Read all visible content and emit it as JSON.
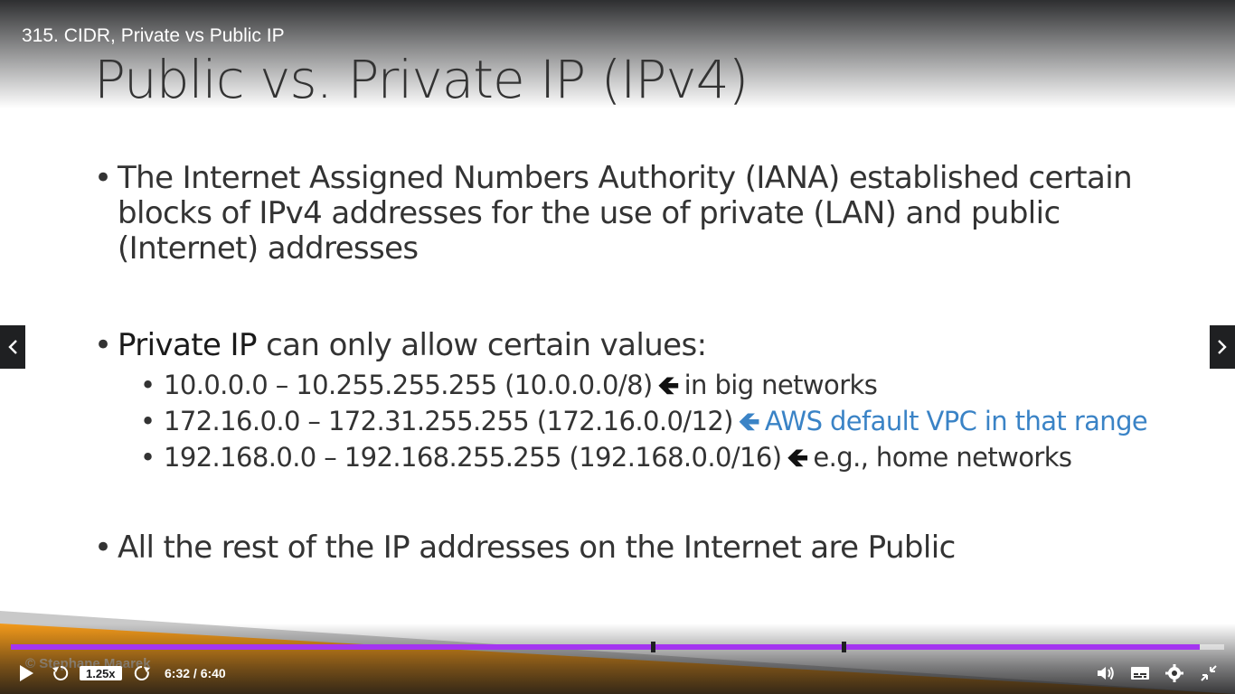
{
  "player": {
    "video_title": "315. CIDR, Private vs Public IP",
    "speed_label": "1.25x",
    "time_display": "6:32 / 6:40",
    "progress_fraction": 0.98,
    "marker_fractions": [
      0.529,
      0.686
    ],
    "colors": {
      "progress": "#a435f0",
      "accent_orange": "#f39a1a"
    },
    "icons": {
      "play": "play-icon",
      "rewind": "rewind-5-icon",
      "forward": "forward-5-icon",
      "volume": "volume-icon",
      "captions": "captions-icon",
      "settings": "gear-icon",
      "fullscreen": "exit-fullscreen-icon",
      "prev": "chevron-left-icon",
      "next": "chevron-right-icon"
    }
  },
  "slide": {
    "title": "Public vs. Private IP (IPv4)",
    "bullet1": "The Internet Assigned Numbers Authority (IANA) established certain blocks of IPv4 addresses for the use of private (LAN) and public (Internet) addresses",
    "bullet2_bold": "Private IP",
    "bullet2_rest": " can only allow certain values:",
    "sub_items": [
      {
        "range": "10.0.0.0 – 10.255.255.255  (10.0.0.0/8)",
        "note": "in big networks"
      },
      {
        "range": "172.16.0.0 – 172.31.255.255 (172.16.0.0/12)",
        "note": "AWS default VPC in that range"
      },
      {
        "range": "192.168.0.0 – 192.168.255.255 (192.168.0.0/16)",
        "note": "e.g., home networks"
      }
    ],
    "bullet3": "All the rest of the IP addresses on the Internet are Public",
    "watermark": "© Stephane Maarek",
    "bullet_glyph": "•",
    "arrow_glyph": "🡸",
    "highlight_color": "#3a83c6"
  }
}
